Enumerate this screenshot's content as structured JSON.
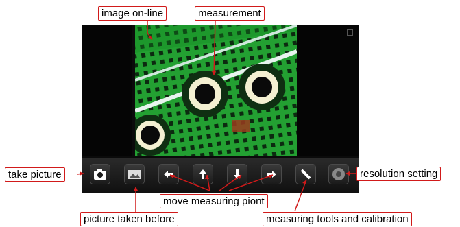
{
  "annotations": {
    "image_online": "image on-line",
    "measurement": "measurement",
    "take_picture": "take picture",
    "resolution_setting": "resolution setting",
    "move_measuring_point": "move measuring piont",
    "picture_taken_before": "picture taken before",
    "measuring_tools": "measuring tools and calibration"
  },
  "toolbar": {
    "buttons": [
      {
        "icon": "camera-icon"
      },
      {
        "icon": "gallery-icon"
      },
      {
        "icon": "arrow-left-icon"
      },
      {
        "icon": "arrow-up-icon"
      },
      {
        "icon": "arrow-down-icon"
      },
      {
        "icon": "arrow-right-icon"
      },
      {
        "icon": "ruler-icon"
      },
      {
        "icon": "settings-icon"
      }
    ]
  },
  "colors": {
    "label_border": "#d11a1a",
    "pcb_green": "#1f8f2c",
    "toolbar": "#1a1a1a"
  }
}
